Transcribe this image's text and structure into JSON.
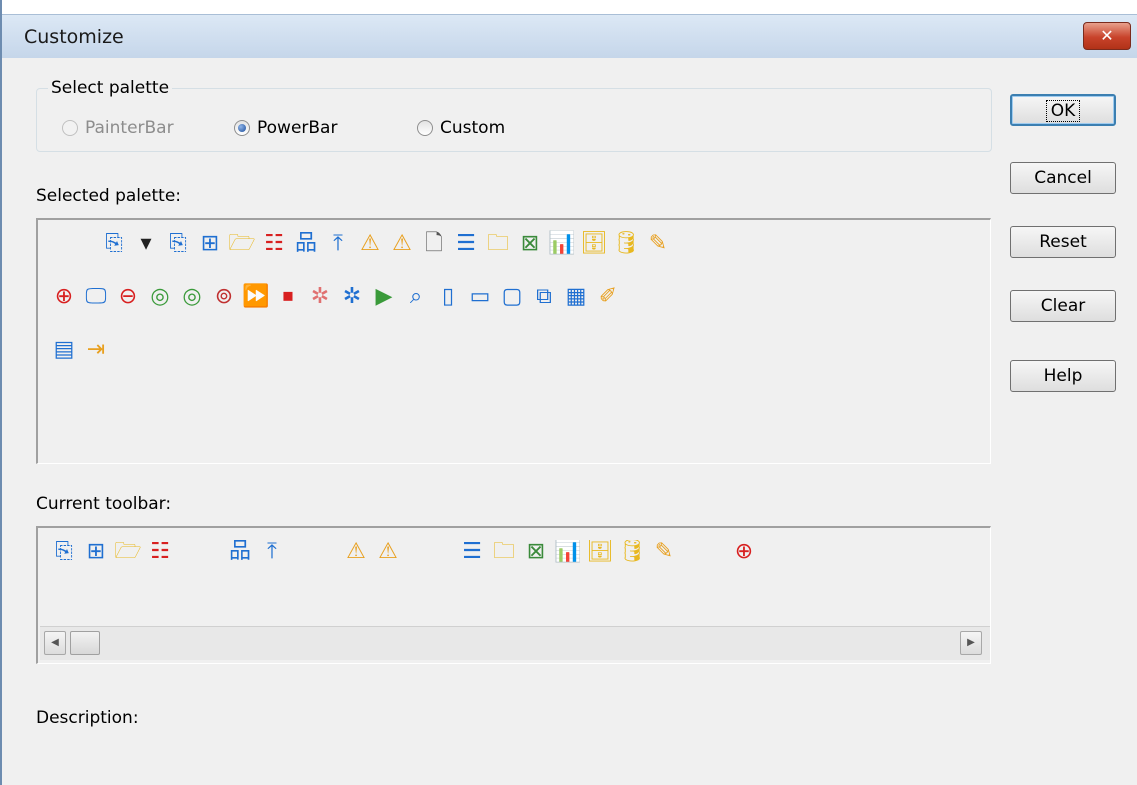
{
  "window": {
    "title": "Customize",
    "close_glyph": "✕"
  },
  "select_palette": {
    "legend": "Select palette",
    "options": [
      {
        "label": "PainterBar",
        "checked": false,
        "disabled": true
      },
      {
        "label": "PowerBar",
        "checked": true,
        "disabled": false
      },
      {
        "label": "Custom",
        "checked": false,
        "disabled": false
      }
    ]
  },
  "selected_palette": {
    "label": "Selected palette:",
    "icons": [
      "new-icon",
      "dropdown-arrow-icon",
      "new-alt-icon",
      "inheritance-icon",
      "open-folder-icon",
      "run-list-icon",
      "library-tree-icon",
      "export-icon",
      "warning-left-icon",
      "warning-right-icon",
      "properties-icon",
      "list-icon",
      "folder-search-icon",
      "delete-object-icon",
      "chart-icon",
      "database-table-icon",
      "database-icon",
      "edit-pencil-icon",
      "monitor-add-icon",
      "monitor-icon",
      "monitor-remove-icon",
      "dial-green-1-icon",
      "dial-green-2-icon",
      "dial-search-icon",
      "window-forward-icon",
      "window-stop-icon",
      "bug-icon",
      "bug-cursor-icon",
      "play-circle-icon",
      "search-cursor-icon",
      "columns-icon",
      "rows-icon",
      "window-icon",
      "cascade-windows-icon",
      "grid-icon",
      "brush-icon",
      "document-list-icon",
      "exit-icon"
    ],
    "icon_glyphs": [
      "⎘",
      "▾",
      "⎘",
      "⊞",
      "🗁",
      "☷",
      "品",
      "⤒",
      "⚠",
      "⚠",
      "🗋",
      "☰",
      "🗀",
      "⊠",
      "📊",
      "🗄",
      "🛢",
      "✎",
      "⊕",
      "🖵",
      "⊖",
      "◎",
      "◎",
      "⊚",
      "⏩",
      "⏹",
      "✲",
      "✲",
      "▶",
      "⌕",
      "▯",
      "▭",
      "▢",
      "⧉",
      "▦",
      "✐",
      "▤",
      "⇥"
    ],
    "icon_colors": [
      "#1f6fd1",
      "#222222",
      "#1f6fd1",
      "#1f6fd1",
      "#e8b820",
      "#d82020",
      "#1f6fd1",
      "#1f6fd1",
      "#e8a020",
      "#e8a020",
      "#555555",
      "#1f6fd1",
      "#e8b820",
      "#3a8a3a",
      "#e8a020",
      "#e8b820",
      "#e8b820",
      "#e8a020",
      "#d82020",
      "#1f6fd1",
      "#d82020",
      "#3a9a3a",
      "#3a9a3a",
      "#c03030",
      "#1f6fd1",
      "#d82020",
      "#e07070",
      "#1f6fd1",
      "#3a9a3a",
      "#1f6fd1",
      "#1f6fd1",
      "#1f6fd1",
      "#1f6fd1",
      "#1f6fd1",
      "#1f6fd1",
      "#e8a020",
      "#1f6fd1",
      "#e8a020"
    ]
  },
  "current_toolbar": {
    "label": "Current toolbar:",
    "icons": [
      "new-icon",
      "inheritance-icon",
      "open-folder-icon",
      "run-list-icon",
      "library-tree-icon",
      "export-icon",
      "warning-left-icon",
      "warning-right-icon",
      "list-icon",
      "folder-search-icon",
      "delete-object-icon",
      "chart-icon",
      "database-table-icon",
      "database-icon",
      "edit-pencil-icon",
      "monitor-add-icon"
    ],
    "icon_glyphs": [
      "⎘",
      "⊞",
      "🗁",
      "☷",
      "品",
      "⤒",
      "⚠",
      "⚠",
      "☰",
      "🗀",
      "⊠",
      "📊",
      "🗄",
      "🛢",
      "✎",
      "⊕"
    ],
    "icon_colors": [
      "#1f6fd1",
      "#1f6fd1",
      "#e8b820",
      "#d82020",
      "#1f6fd1",
      "#1f6fd1",
      "#e8a020",
      "#e8a020",
      "#1f6fd1",
      "#e8b820",
      "#3a8a3a",
      "#e8a020",
      "#e8b820",
      "#e8b820",
      "#e8a020",
      "#d82020"
    ]
  },
  "scrollbar": {
    "left_glyph": "◀",
    "right_glyph": "▶"
  },
  "description": {
    "label": "Description:"
  },
  "buttons": {
    "ok": "OK",
    "cancel": "Cancel",
    "reset": "Reset",
    "clear": "Clear",
    "help": "Help"
  }
}
